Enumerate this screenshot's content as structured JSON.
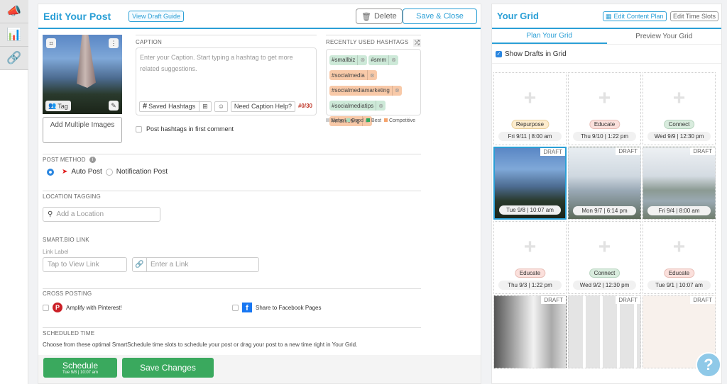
{
  "sidebar": {
    "items": [
      {
        "icon": "megaphone-icon",
        "glyph": "📣"
      },
      {
        "icon": "bar-chart-icon",
        "glyph": "📊"
      },
      {
        "icon": "link-icon",
        "glyph": "🔗"
      }
    ]
  },
  "edit": {
    "title": "Edit Your Post",
    "draft_guide": "View Draft Guide",
    "delete": "Delete",
    "save_close": "Save & Close",
    "tag": "Tag",
    "add_multiple": "Add Multiple Images",
    "caption_label": "CAPTION",
    "caption_placeholder": "Enter your Caption. Start typing a hashtag to get more related suggestions.",
    "saved_hashtags": "Saved Hashtags",
    "caption_help": "Need Caption Help?",
    "hashtag_count": "#0/30",
    "hashtags_label": "RECENTLY USED HASHTAGS",
    "hashtags": [
      {
        "tag": "#smallbiz",
        "type": "g"
      },
      {
        "tag": "#smm",
        "type": "g"
      },
      {
        "tag": "#socialmedia",
        "type": "o"
      },
      {
        "tag": "#socialmediamarketing",
        "type": "o"
      },
      {
        "tag": "#socialmediatips",
        "type": "g"
      },
      {
        "tag": "#marketing",
        "type": "o"
      }
    ],
    "legend": [
      {
        "label": "Niche",
        "color": "#cccccc"
      },
      {
        "label": "Good",
        "color": "#a8dcbc"
      },
      {
        "label": "Best",
        "color": "#2eaa5c"
      },
      {
        "label": "Competitive",
        "color": "#f5a36c"
      }
    ],
    "first_comment": "Post hashtags in first comment",
    "post_method_label": "POST METHOD",
    "auto_post": "Auto Post",
    "notification_post": "Notification Post",
    "location_label": "LOCATION TAGGING",
    "location_placeholder": "Add a Location",
    "smartbio_label": "SMART.BIO LINK",
    "link_label": "Link Label",
    "link_label_placeholder": "Tap to View Link",
    "link_placeholder": "Enter a Link",
    "cross_label": "CROSS POSTING",
    "pinterest": "Amplify with Pinterest!",
    "facebook": "Share to Facebook Pages",
    "scheduled_label": "SCHEDULED TIME",
    "scheduled_text": "Choose from these optimal SmartSchedule time slots to schedule your post or drag your post to a new time right in Your Grid.",
    "schedule": "Schedule",
    "schedule_time": "Tue 9/8 | 10:07 am",
    "save_changes": "Save Changes"
  },
  "grid": {
    "title": "Your Grid",
    "edit_plan": "Edit Content Plan",
    "edit_slots": "Edit Time Slots",
    "tabs": [
      "Plan Your Grid",
      "Preview Your Grid"
    ],
    "show_drafts": "Show Drafts in Grid",
    "cells": [
      {
        "kind": "empty",
        "pill": "Repurpose",
        "pclass": "p-repurpose",
        "date": "Fri 9/11 | 8:00 am"
      },
      {
        "kind": "empty",
        "pill": "Educate",
        "pclass": "p-educate",
        "date": "Thu 9/10 | 1:22 pm"
      },
      {
        "kind": "empty",
        "pill": "Connect",
        "pclass": "p-connect",
        "date": "Wed 9/9 | 12:30 pm"
      },
      {
        "kind": "draft",
        "img": "dusk",
        "date": "Tue 9/8 | 10:07 am",
        "selected": true
      },
      {
        "kind": "draft",
        "img": "sea",
        "date": "Mon 9/7 | 6:14 pm"
      },
      {
        "kind": "draft",
        "img": "sea2",
        "date": "Fri 9/4 | 8:00 am"
      },
      {
        "kind": "empty",
        "pill": "Educate",
        "pclass": "p-educate",
        "date": "Thu 9/3 | 1:22 pm"
      },
      {
        "kind": "empty",
        "pill": "Connect",
        "pclass": "p-connect",
        "date": "Wed 9/2 | 12:30 pm"
      },
      {
        "kind": "empty",
        "pill": "Educate",
        "pclass": "p-educate",
        "date": "Tue 9/1 | 10:07 am"
      },
      {
        "kind": "draft",
        "img": "bw",
        "date": ""
      },
      {
        "kind": "draft",
        "img": "tiles",
        "date": ""
      },
      {
        "kind": "draft",
        "img": "pastel",
        "date": ""
      }
    ],
    "draft_label": "DRAFT"
  },
  "help": "?"
}
